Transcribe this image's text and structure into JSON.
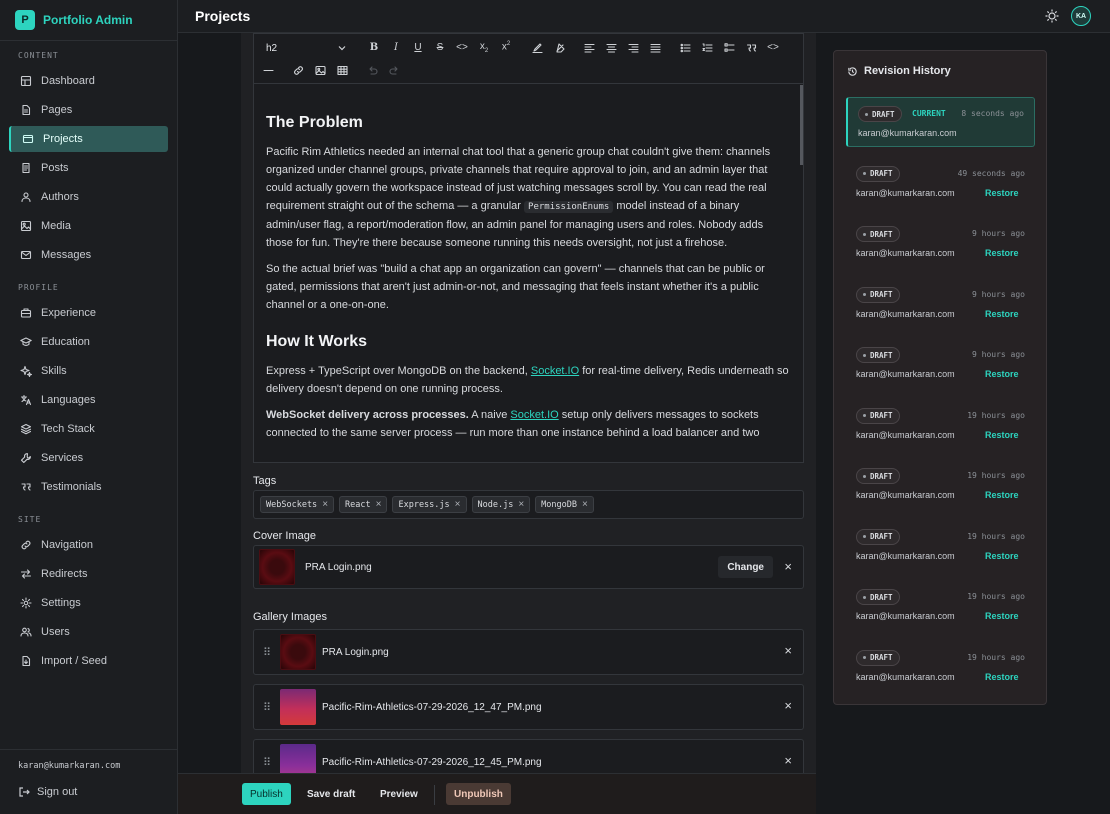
{
  "app": {
    "name": "Portfolio Admin",
    "logo_letter": "P"
  },
  "sidebar": {
    "sections": [
      {
        "title": "CONTENT",
        "items": [
          {
            "label": "Dashboard",
            "icon": "dashboard-icon"
          },
          {
            "label": "Pages",
            "icon": "page-icon"
          },
          {
            "label": "Projects",
            "icon": "projects-icon",
            "active": true
          },
          {
            "label": "Posts",
            "icon": "posts-icon"
          },
          {
            "label": "Authors",
            "icon": "user-icon"
          },
          {
            "label": "Media",
            "icon": "image-icon"
          },
          {
            "label": "Messages",
            "icon": "mail-icon"
          }
        ]
      },
      {
        "title": "PROFILE",
        "items": [
          {
            "label": "Experience",
            "icon": "briefcase-icon"
          },
          {
            "label": "Education",
            "icon": "graduation-cap-icon"
          },
          {
            "label": "Skills",
            "icon": "sparkles-icon"
          },
          {
            "label": "Languages",
            "icon": "languages-icon"
          },
          {
            "label": "Tech Stack",
            "icon": "stack-icon"
          },
          {
            "label": "Services",
            "icon": "wrench-icon"
          },
          {
            "label": "Testimonials",
            "icon": "quote-icon"
          }
        ]
      },
      {
        "title": "SITE",
        "items": [
          {
            "label": "Navigation",
            "icon": "link-icon"
          },
          {
            "label": "Redirects",
            "icon": "arrows-icon"
          },
          {
            "label": "Settings",
            "icon": "gear-icon"
          },
          {
            "label": "Users",
            "icon": "users-icon"
          },
          {
            "label": "Import / Seed",
            "icon": "file-import-icon"
          }
        ]
      }
    ],
    "user_email": "karan@kumarkaran.com",
    "signout_label": "Sign out"
  },
  "topbar": {
    "title": "Projects",
    "avatar_initials": "KA"
  },
  "editor": {
    "heading_select": "h2",
    "h2_problem": "The Problem",
    "p1_a": "Pacific Rim Athletics needed an internal chat tool that a generic group chat couldn't give them: channels organized under channel groups, private channels that require approval to join, and an admin layer that could actually govern the workspace instead of just watching messages scroll by. You can read the real requirement straight out of the schema — a granular ",
    "p1_code": "PermissionEnums",
    "p1_b": " model instead of a binary admin/user flag, a report/moderation flow, an admin panel for managing users and roles. Nobody adds those for fun. They're there because someone running this needs oversight, not just a firehose.",
    "p2": "So the actual brief was \"build a chat app an organization can govern\" — channels that can be public or gated, permissions that aren't just admin-or-not, and messaging that feels instant whether it's a public channel or a one-on-one.",
    "h2_how": "How It Works",
    "p3_a": "Express + TypeScript over MongoDB on the backend, ",
    "p3_link": "Socket.IO",
    "p3_b": " for real-time delivery, Redis underneath so delivery doesn't depend on one running process.",
    "p4_bold": "WebSocket delivery across processes.",
    "p4_a": " A naive ",
    "p4_link": "Socket.IO",
    "p4_b": " setup only delivers messages to sockets connected to the same server process — run more than one instance behind a load balancer and two"
  },
  "tags": {
    "label": "Tags",
    "items": [
      "WebSockets",
      "React",
      "Express.js",
      "Node.js",
      "MongoDB"
    ],
    "remove_glyph": "×"
  },
  "cover": {
    "label": "Cover Image",
    "filename": "PRA Login.png",
    "change_label": "Change",
    "remove_glyph": "×"
  },
  "gallery": {
    "label": "Gallery Images",
    "items": [
      {
        "filename": "PRA Login.png"
      },
      {
        "filename": "Pacific-Rim-Athletics-07-29-2026_12_47_PM.png"
      },
      {
        "filename": "Pacific-Rim-Athletics-07-29-2026_12_45_PM.png"
      }
    ],
    "remove_glyph": "×",
    "drag_glyph": "⠿"
  },
  "actions": {
    "publish": "Publish",
    "save_draft": "Save draft",
    "preview": "Preview",
    "unpublish": "Unpublish"
  },
  "revisions": {
    "title": "Revision History",
    "restore_label": "Restore",
    "current_label": "CURRENT",
    "items": [
      {
        "status": "DRAFT",
        "time": "8 seconds ago",
        "email": "karan@kumarkaran.com",
        "current": true
      },
      {
        "status": "DRAFT",
        "time": "49 seconds ago",
        "email": "karan@kumarkaran.com"
      },
      {
        "status": "DRAFT",
        "time": "9 hours ago",
        "email": "karan@kumarkaran.com"
      },
      {
        "status": "DRAFT",
        "time": "9 hours ago",
        "email": "karan@kumarkaran.com"
      },
      {
        "status": "DRAFT",
        "time": "9 hours ago",
        "email": "karan@kumarkaran.com"
      },
      {
        "status": "DRAFT",
        "time": "19 hours ago",
        "email": "karan@kumarkaran.com"
      },
      {
        "status": "DRAFT",
        "time": "19 hours ago",
        "email": "karan@kumarkaran.com"
      },
      {
        "status": "DRAFT",
        "time": "19 hours ago",
        "email": "karan@kumarkaran.com"
      },
      {
        "status": "DRAFT",
        "time": "19 hours ago",
        "email": "karan@kumarkaran.com"
      },
      {
        "status": "DRAFT",
        "time": "19 hours ago",
        "email": "karan@kumarkaran.com"
      }
    ]
  },
  "colors": {
    "accent": "#2dd4bf",
    "background": "#17191c",
    "sidebar": "#1c1e21",
    "unpublish": "#4a3a34"
  }
}
